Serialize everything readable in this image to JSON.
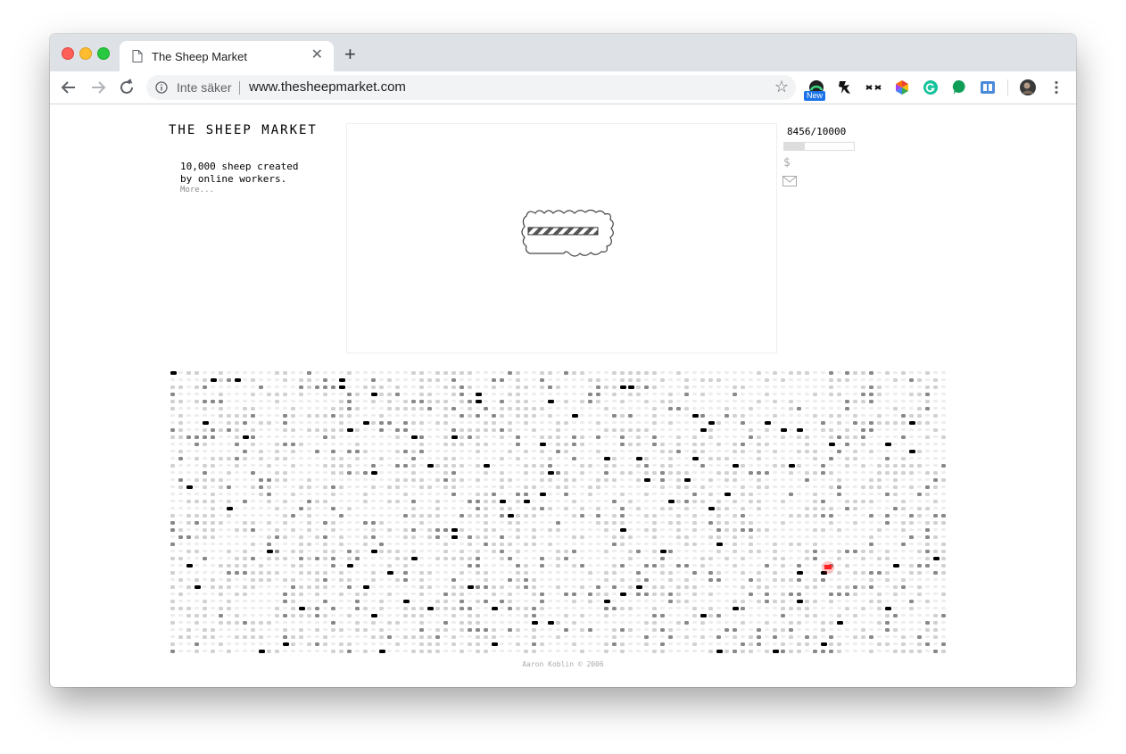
{
  "browser": {
    "tab_title": "The Sheep Market",
    "new_tab_label": "+",
    "close_tab_label": "✕",
    "security_label": "Inte säker",
    "url": "www.thesheepmarket.com",
    "extension_badge": "New"
  },
  "site": {
    "title": "THE SHEEP MARKET",
    "tagline": "10,000 sheep created by online workers.",
    "more_link": "More...",
    "counter": "8456/10000",
    "progress": 0.3,
    "dollar_icon": "$",
    "footer": "Aaron Koblin © 2006"
  },
  "colors": {
    "highlight_sheep": "#ff2020",
    "tab_strip": "#dee1e6"
  }
}
